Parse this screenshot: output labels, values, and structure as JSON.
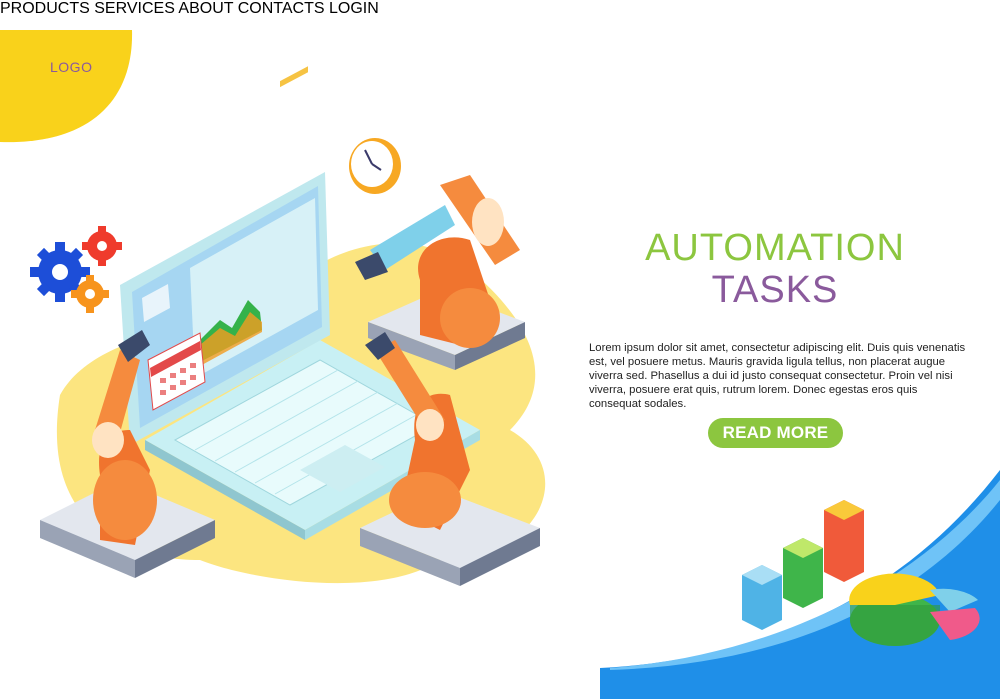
{
  "header": {
    "logo": "LOGO",
    "nav": [
      {
        "label": "PRODUCTS"
      },
      {
        "label": "SERVICES"
      },
      {
        "label": "ABOUT"
      },
      {
        "label": "CONTACTS"
      },
      {
        "label": "LOGIN"
      }
    ]
  },
  "hero": {
    "title_line1": "AUTOMATION",
    "title_line2": "TASKS",
    "description": "Lorem ipsum dolor sit amet, consectetur adipiscing elit. Duis quis venenatis est, vel posuere metus. Mauris gravida ligula tellus, non placerat augue viverra sed. Phasellus a dui id justo consequat consectetur. Proin vel nisi viverra, posuere erat quis, rutrum lorem. Donec egestas eros quis consequat sodales.",
    "button_label": "READ MORE"
  },
  "colors": {
    "accent_green": "#8cc63f",
    "accent_purple": "#8a5a9c",
    "logo_blob": "#f9d21b",
    "corner_blue": "#2196f3"
  },
  "icons": [
    "gear-icon",
    "clock-icon",
    "laptop-icon",
    "robot-arm-icon",
    "bar-chart-icon",
    "pie-chart-icon"
  ]
}
